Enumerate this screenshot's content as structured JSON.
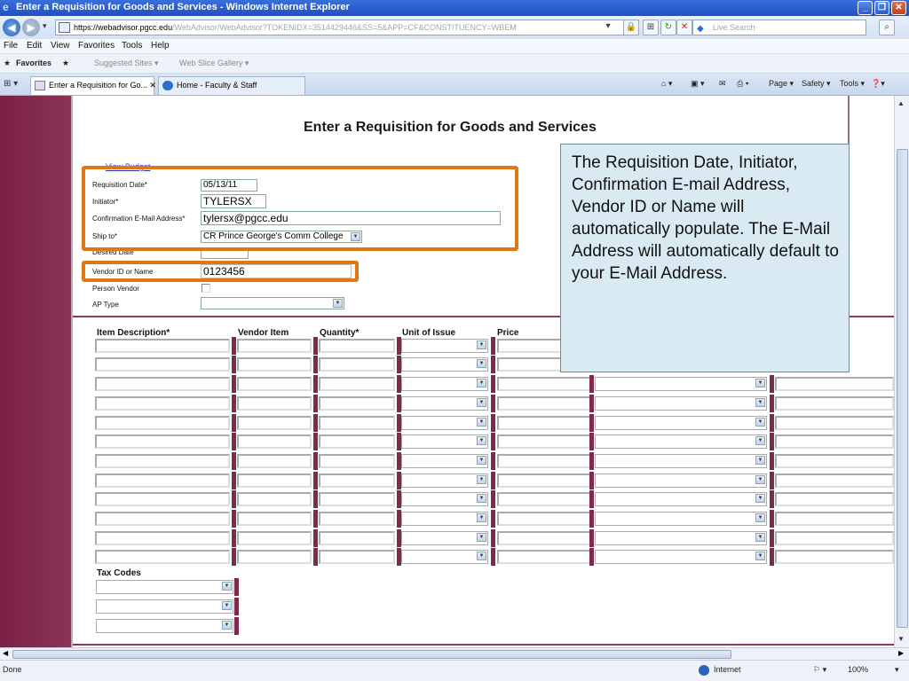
{
  "window": {
    "title": "Enter a Requisition for Goods and Services - Windows Internet Explorer",
    "min_glyph": "_",
    "max_glyph": "❐",
    "close_glyph": "✕"
  },
  "address_bar": {
    "scheme": "https://",
    "host": "webadvisor.pgcc.edu",
    "path": "/WebAdvisor/WebAdvisor?TOKENIDX=3514429446&SS=5&APP=CF&CONSTITUENCY=WBEM",
    "live_search_placeholder": "Live Search"
  },
  "menu": [
    "File",
    "Edit",
    "View",
    "Favorites",
    "Tools",
    "Help"
  ],
  "favorites_bar": {
    "favorites": "Favorites",
    "suggested": "Suggested Sites ▾",
    "slice": "Web Slice Gallery ▾"
  },
  "tabs": [
    {
      "label": "Enter a Requisition for Go...  ✕"
    },
    {
      "label": "Home - Faculty & Staff"
    }
  ],
  "command_bar": {
    "page": "Page ▾",
    "safety": "Safety ▾",
    "tools": "Tools ▾",
    "help": "❓▾"
  },
  "page": {
    "title": "Enter a Requisition for Goods and Services",
    "view_budget": "View Budget",
    "fields": {
      "requisition_date_label": "Requisition Date*",
      "requisition_date": "05/13/11",
      "initiator_label": "Initiator*",
      "initiator": "TYLERSX",
      "email_label": "Confirmation E-Mail Address*",
      "email": "tylersx@pgcc.edu",
      "ship_to_label": "Ship to*",
      "ship_to": "CR Prince George's Comm College",
      "desired_date_label": "Desired Date",
      "vendor_label": "Vendor ID or Name",
      "vendor": "0123456",
      "person_vendor_label": "Person Vendor",
      "ap_type_label": "AP Type"
    },
    "columns": [
      "Item Description*",
      "Vendor Item",
      "Quantity*",
      "Unit of Issue",
      "Price"
    ],
    "tax_codes_label": "Tax Codes"
  },
  "callout": {
    "text": "The Requisition Date, Initiator, Confirmation E-mail Address, Vendor ID or Name will automatically populate. The E-Mail Address will automatically default to your E-Mail Address."
  },
  "status_bar": {
    "status": "Done",
    "zone": "Internet",
    "zoom": "100%"
  }
}
